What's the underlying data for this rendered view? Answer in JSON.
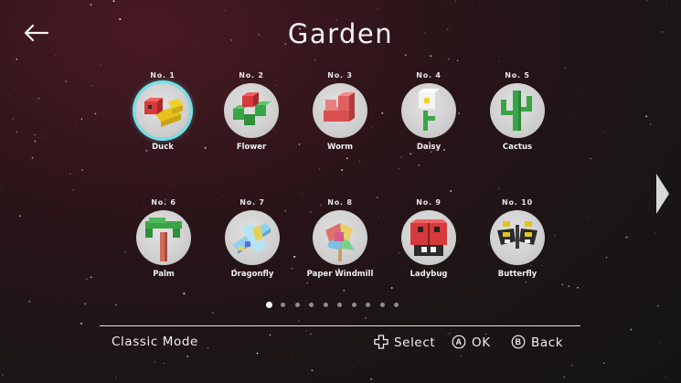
{
  "header": {
    "title": "Garden",
    "back_icon": "arrow-left-icon"
  },
  "items": [
    {
      "no": "No. 1",
      "name": "Duck"
    },
    {
      "no": "No. 2",
      "name": "Flower"
    },
    {
      "no": "No. 3",
      "name": "Worm"
    },
    {
      "no": "No. 4",
      "name": "Daisy"
    },
    {
      "no": "No. 5",
      "name": "Cactus"
    },
    {
      "no": "No. 6",
      "name": "Palm"
    },
    {
      "no": "No. 7",
      "name": "Dragonfly"
    },
    {
      "no": "No. 8",
      "name": "Paper Windmill"
    },
    {
      "no": "No. 9",
      "name": "Ladybug"
    },
    {
      "no": "No. 10",
      "name": "Butterfly"
    }
  ],
  "selected_item": "Duck",
  "pagination": {
    "pages": 10,
    "current": 1
  },
  "footer": {
    "mode": "Classic Mode",
    "select_label": "Select",
    "ok_label": "OK",
    "back_label": "Back",
    "ok_button": "A",
    "back_button": "B"
  },
  "colors": {
    "accent": "#6fe3ea",
    "text": "#f0f0f0"
  }
}
